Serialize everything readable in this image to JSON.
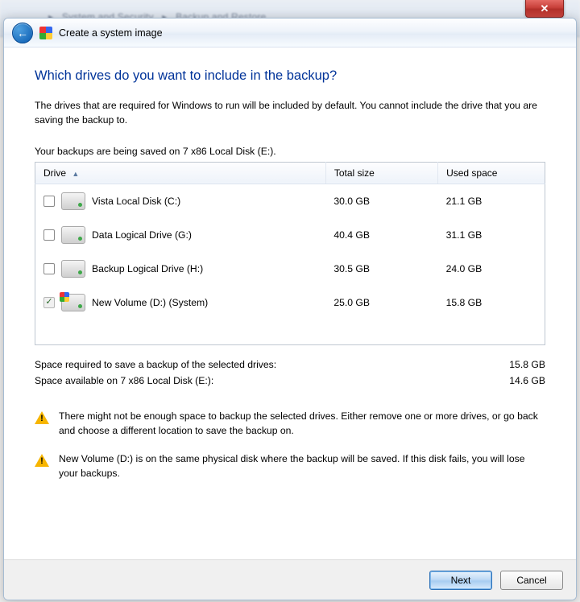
{
  "window": {
    "title": "Create a system image",
    "close_glyph": "✕"
  },
  "content": {
    "heading": "Which drives do you want to include in the backup?",
    "description": "The drives that are required for Windows to run will be included by default. You cannot include the drive that you are saving the backup to.",
    "saved_on_line": "Your backups are being saved on 7 x86 Local Disk (E:)."
  },
  "table": {
    "columns": {
      "drive": "Drive",
      "total": "Total size",
      "used": "Used space"
    },
    "rows": [
      {
        "name": "Vista Local Disk (C:)",
        "total": "30.0 GB",
        "used": "21.1 GB",
        "checked": false,
        "disabled": false,
        "system": false
      },
      {
        "name": "Data Logical Drive (G:)",
        "total": "40.4 GB",
        "used": "31.1 GB",
        "checked": false,
        "disabled": false,
        "system": false
      },
      {
        "name": "Backup Logical Drive (H:)",
        "total": "30.5 GB",
        "used": "24.0 GB",
        "checked": false,
        "disabled": false,
        "system": false
      },
      {
        "name": "New Volume (D:) (System)",
        "total": "25.0 GB",
        "used": "15.8 GB",
        "checked": true,
        "disabled": true,
        "system": true
      }
    ]
  },
  "summary": {
    "required_label": "Space required to save a backup of the selected drives:",
    "required_value": "15.8 GB",
    "available_label": "Space available on 7 x86 Local Disk (E:):",
    "available_value": "14.6 GB"
  },
  "warnings": [
    "There might not be enough space to backup the selected drives. Either remove one or more drives, or go back and choose a different location to save the backup on.",
    "New Volume (D:) is on the same physical disk where the backup will be saved. If this disk fails, you will lose your backups."
  ],
  "buttons": {
    "next": "Next",
    "cancel": "Cancel"
  }
}
